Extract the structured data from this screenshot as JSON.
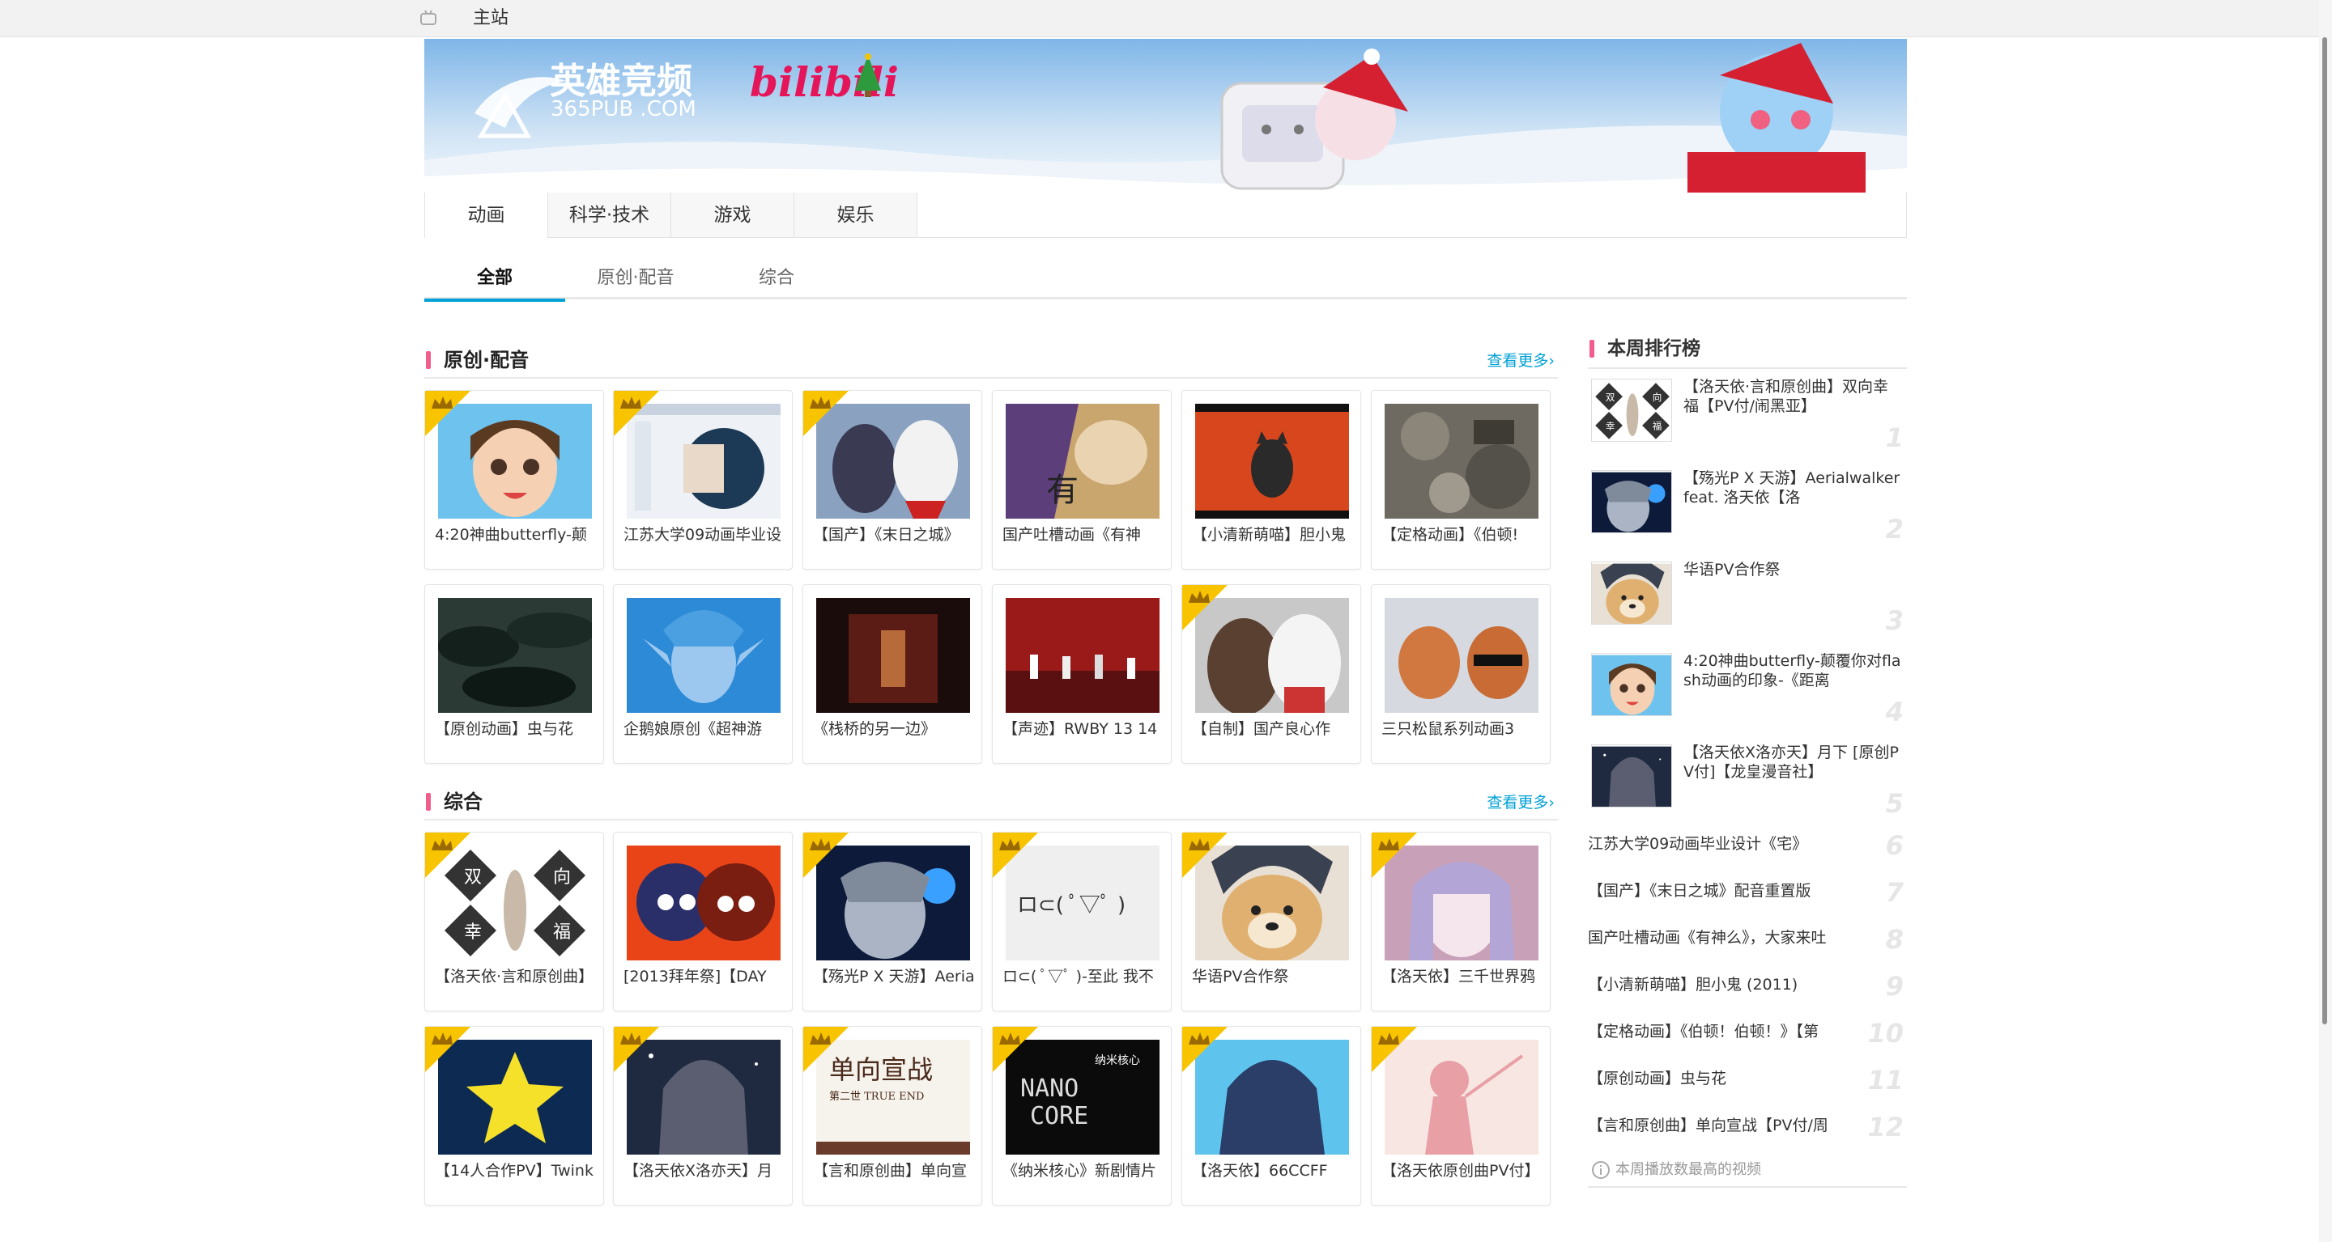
{
  "topbar": {
    "home_label": "主站"
  },
  "banner": {
    "logo_cn": "英雄竞频",
    "logo_domain": "365PUB .COM",
    "brand": "bilibili"
  },
  "nav": {
    "items": [
      "动画",
      "科学·技术",
      "游戏",
      "娱乐"
    ],
    "active": "动画"
  },
  "subtabs": {
    "items": [
      "全部",
      "原创·配音",
      "综合"
    ],
    "active": "全部"
  },
  "sections": [
    {
      "title": "原创·配音",
      "more": "查看更多›",
      "cards": [
        {
          "caption": "4:20神曲butterfly-颠",
          "icon": "cartoon-girl",
          "crown": true
        },
        {
          "caption": "江苏大学09动画毕业设",
          "icon": "drawing-app",
          "crown": true
        },
        {
          "caption": "【国产】《末日之城》",
          "icon": "anime-duo",
          "crown": true
        },
        {
          "caption": "国产吐槽动画《有神",
          "icon": "god-poster",
          "crown": false
        },
        {
          "caption": "【小清新萌喵】胆小鬼",
          "icon": "cat-silhouette",
          "crown": false
        },
        {
          "caption": "【定格动画】《伯顿!",
          "icon": "rubble",
          "crown": false
        },
        {
          "caption": "【原创动画】虫与花",
          "icon": "dark-leaves",
          "crown": false
        },
        {
          "caption": "企鹅娘原创《超神游",
          "icon": "elf-boy",
          "crown": false
        },
        {
          "caption": "《栈桥的另一边》",
          "icon": "dark-room",
          "crown": false
        },
        {
          "caption": "【声迹】RWBY 13 14",
          "icon": "red-stage",
          "crown": false
        },
        {
          "caption": "【自制】国产良心作",
          "icon": "anime-duo-2",
          "crown": true
        },
        {
          "caption": "三只松鼠系列动画3",
          "icon": "squirrel",
          "crown": false
        }
      ]
    },
    {
      "title": "综合",
      "more": "查看更多›",
      "cards": [
        {
          "caption": "【洛天依·言和原创曲】",
          "icon": "double-happiness",
          "crown": true
        },
        {
          "caption": "[2013拜年祭]【DAY",
          "icon": "chibi-pair",
          "crown": false
        },
        {
          "caption": "【殇光P X 天游】Aeria",
          "icon": "luo-tianyi",
          "crown": true
        },
        {
          "caption": "ロ⊂( ﾟ▽ﾟ )-至此 我不",
          "icon": "kaomoji",
          "crown": true
        },
        {
          "caption": "华语PV合作祭",
          "icon": "doge",
          "crown": true
        },
        {
          "caption": "【洛天依】三千世界鸦",
          "icon": "purple-girl",
          "crown": true
        },
        {
          "caption": "【14人合作PV】Twink",
          "icon": "star",
          "crown": true
        },
        {
          "caption": "【洛天依X洛亦天】月",
          "icon": "moon-girl",
          "crown": true
        },
        {
          "caption": "【言和原创曲】单向宣",
          "icon": "declaration",
          "crown": true
        },
        {
          "caption": "《纳米核心》新剧情片",
          "icon": "nano-core",
          "crown": true
        },
        {
          "caption": "【洛天依】66CCFF",
          "icon": "blue-girl",
          "crown": true
        },
        {
          "caption": "【洛天依原创曲PV付】",
          "icon": "pink-silhouette",
          "crown": true
        }
      ]
    }
  ],
  "ranking": {
    "title": "本周排行榜",
    "top": [
      {
        "rank": "1",
        "title": "【洛天依·言和原创曲】双向幸福【PV付/闹黑亚】"
      },
      {
        "rank": "2",
        "title": "【殇光P X 天游】Aerialwalker feat. 洛天依【洛"
      },
      {
        "rank": "3",
        "title": "华语PV合作祭"
      },
      {
        "rank": "4",
        "title": "4:20神曲butterfly-颠覆你对flash动画的印象-《距离"
      },
      {
        "rank": "5",
        "title": "【洛天依X洛亦天】月下 [原创PV付]【龙皇漫音社】"
      }
    ],
    "rest": [
      {
        "rank": "6",
        "title": "江苏大学09动画毕业设计《宅》"
      },
      {
        "rank": "7",
        "title": "【国产】《末日之城》配音重置版"
      },
      {
        "rank": "8",
        "title": "国产吐槽动画《有神么》，大家来吐"
      },
      {
        "rank": "9",
        "title": "【小清新萌喵】胆小鬼 (2011)"
      },
      {
        "rank": "10",
        "title": "【定格动画】《伯顿！伯顿！》【第"
      },
      {
        "rank": "11",
        "title": "【原创动画】虫与花"
      },
      {
        "rank": "12",
        "title": "【言和原创曲】单向宣战【PV付/周"
      }
    ],
    "footer_note": "本周播放数最高的视频"
  }
}
